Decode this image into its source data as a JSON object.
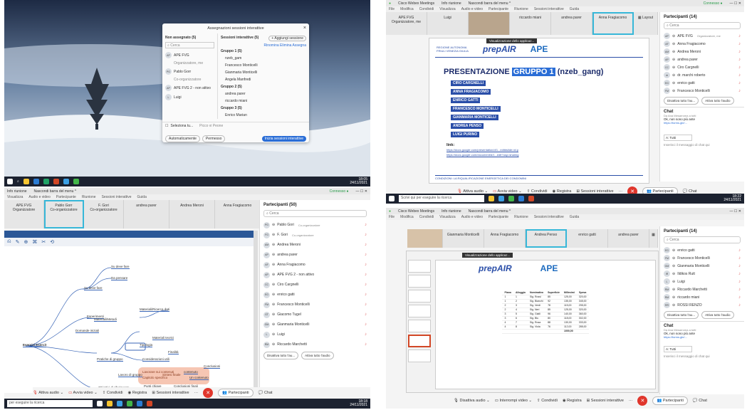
{
  "tl": {
    "dialog": {
      "title": "Assegnazioni sessioni interattive",
      "unassigned_header": "Non assegnato (5)",
      "sessions_header": "Sessioni interattive (5)",
      "add_session": "+ Aggiungi sessione",
      "search_placeholder": "Cerca",
      "actions": "Rinomina  Elimina  Assegna",
      "unassigned": [
        "APE FVG",
        "Organizzatore, me",
        "Pablo Gorr",
        "Co-organizzatore",
        "APE FVG 2 - non attivo",
        "Luigi"
      ],
      "sessions": [
        "Gruppo 1 (5)",
        "nzeb_gam",
        "Francesco Monticelli",
        "Gianmaria Monticelli",
        "Angela Manfredi",
        "Gruppo 2 (5)",
        "andrea parer",
        "riccardo miani",
        "Gruppo 3 (5)",
        "Enrico Marian"
      ],
      "select_all": "Seleziona tu...",
      "pick_participant": "Picco vi Peone",
      "btn_automatic": "Automaticamente",
      "btn_manually": "Permesso",
      "btn_start": "Inizia sessioni interattive"
    },
    "taskbar": {
      "clock": "18:05",
      "date": "24/11/2021"
    }
  },
  "tr": {
    "titlebar": [
      "Cisco Webex Meetings",
      "Info riunione",
      "Nascondi barra del menu ^"
    ],
    "connected": "Connesso ●",
    "menu": [
      "File",
      "Modifica",
      "Condividi",
      "Visualizza",
      "Audio e video",
      "Partecipante",
      "Riunione",
      "Sessioni interattive",
      "Guida"
    ],
    "tiles": [
      "APE FVG\nOrganizzatore, me",
      "Luigi",
      "",
      "riccardo miani",
      "andrea parer",
      "Anna Fragiacomo"
    ],
    "layout_btn": "Layout",
    "slide": {
      "banner": "Visualizzazione dello applicaz...",
      "logo_left": "REGIONE AUTONOMA FRIULI VENEZIA GIULIA",
      "logo_mid": "prepAIR",
      "logo_right": "APE",
      "title_pre": "PRESENTAZIONE",
      "title_hl": "GRUPPO 1",
      "title_post": "(nzeb_gang)",
      "members": [
        "CIRO CARGNELLI",
        "ANNA FRAGIACOMO",
        "ENRICO GATTI",
        "FRANCESCO MONTICELLI",
        "GIANMARIA MONTICELLI",
        "ANDREA PENSO",
        "LUIGI PURINO"
      ],
      "link_label": "link:",
      "link1": "https://docs.google.com/presentation/d/1...edit#slide=id.p",
      "link2": "https://docs.google.com/document/d/1...edit?usp=sharing",
      "footer": "CONDIZIONI: LA RIQUALIFICAZIONE ENERGETICA DEI CONDOMINI"
    },
    "people": {
      "header": "Partecipanti (14)",
      "search": "Cerca",
      "list": [
        [
          "AP",
          "APE FVG",
          "Organizzatore, me"
        ],
        [
          "AF",
          "Anna Fragiacomo",
          ""
        ],
        [
          "AM",
          "Andrea Meroni",
          ""
        ],
        [
          "AP",
          "andrea parer",
          ""
        ],
        [
          "CC",
          "Ciro Cargnelli",
          ""
        ],
        [
          "dr",
          "dr. marchi roberto",
          ""
        ],
        [
          "EG",
          "enrico gatti",
          ""
        ],
        [
          "FM",
          "Francesco Monticelli",
          ""
        ]
      ],
      "btn_mute": "Disattiva tutto l'au...",
      "btn_unmute": "Attiva tutto l'audio",
      "chat_header": "Chat",
      "chat_from": "Da Ana Mesarroma a tutti",
      "chat_msg": "Ok, non sono più ante",
      "chat_link": "https://forms.gle/...",
      "to": "A: Tutti",
      "input": "Inserisci il messaggio di chat qui"
    },
    "controls": [
      "Attiva audio",
      "Avvia video",
      "Condividi",
      "Registra",
      "Sessioni interattive",
      "Partecipanti",
      "Chat"
    ],
    "taskbar": {
      "search": "Scrivi qui per eseguire la ricerca",
      "clock": "18:22",
      "date": "24/11/2021"
    }
  },
  "bl": {
    "titlebar": [
      "Info riunione",
      "Nascondi barra del menu ^"
    ],
    "connected": "Connesso ●",
    "menu": [
      "Visualizza",
      "Audio e video",
      "Partecipante",
      "Riunione",
      "Sessioni interattive",
      "Guida"
    ],
    "tiles": [
      "APE FVG\nOrganizzatore",
      "Pablo Gorr\nCo-organizzatore",
      "F. Gori\nCo-organizzatore",
      "andrea parer",
      "Andrea Meroni",
      "Anna Fragiacomo"
    ],
    "mindmap": {
      "root": "Esercizi Esercit",
      "nodes": [
        "Su deve fare",
        "Su deve fare",
        "Da pensare",
        "Esperimenti",
        "Materiali/Metodi",
        "Materiali/Ricerca dati",
        "Domande iniziali",
        "Materiali teorici",
        "Tipologia",
        "Finalità",
        "Pratiche di gruppo",
        "Considerazioni utili",
        "Obiettivi di riferimento",
        "Lavoro di gruppo",
        "Punti chiave",
        "Conclusioni finali",
        "A lezione",
        "contenuto",
        "Un contenuto",
        "Conclusioni"
      ],
      "pink": [
        "Lavorare sui contenuti",
        "Capitolo specifico",
        "Sintesi finale",
        "Lezione"
      ]
    },
    "people": {
      "header": "Partecipanti (50)",
      "search": "Cerca",
      "list": [
        [
          "PG",
          "Pablo Gori",
          "Co-organizzatore"
        ],
        [
          "FG",
          "F. Gori",
          "Co-organizzatore"
        ],
        [
          "AM",
          "Andrea Meroni",
          ""
        ],
        [
          "AP",
          "andrea parer",
          ""
        ],
        [
          "AF",
          "Anna Fragiacomo",
          ""
        ],
        [
          "AP",
          "APE FVG 2 - non attivo",
          ""
        ],
        [
          "CC",
          "Ciro Cargnelli",
          ""
        ],
        [
          "EG",
          "enrico gatti",
          ""
        ],
        [
          "FM",
          "Francesco Monticelli",
          ""
        ],
        [
          "GT",
          "Giacomo Tugel",
          ""
        ],
        [
          "GM",
          "Gianmaria Monticelli",
          ""
        ],
        [
          "L",
          "Luigi",
          ""
        ],
        [
          "RM",
          "Riccardo Marchetti",
          ""
        ]
      ],
      "btn_mute": "Disattiva tutto l'au...",
      "btn_unmute": "Attiva tutto l'audio"
    },
    "controls": [
      "Attiva audio",
      "Avvia video",
      "Condividi",
      "Registra",
      "Sessioni interattive",
      "Partecipanti",
      "Chat"
    ],
    "taskbar": {
      "search": "per eseguire la ricerca",
      "clock": "18:18",
      "date": "24/11/2021"
    }
  },
  "br": {
    "titlebar": [
      "Cisco Webex Meetings",
      "Info riunione",
      "Nascondi barra del menu ^"
    ],
    "menu": [
      "File",
      "Modifica",
      "Condividi",
      "Visualizza",
      "Audio e video",
      "Partecipante",
      "Riunione",
      "Sessioni interattive",
      "Guida"
    ],
    "tiles": [
      "",
      "Gianmaria Monticelli",
      "Anna Fragiacomo",
      "Andrea Penso",
      "enrico gatti",
      "andrea parer"
    ],
    "layout_btn": "Layout",
    "banner": "Visualizzazione dello applicaz...",
    "logo_mid": "prepAIR",
    "logo_right": "APE",
    "table": {
      "headers": [
        "Piano",
        "Alloggio",
        "Nominativo",
        "Superficie",
        "Millesimi",
        "Spesa"
      ],
      "rows": [
        [
          "1",
          "1",
          "Sig. Rossi",
          "85",
          "125,00",
          "320,00"
        ],
        [
          "1",
          "2",
          "Sig. Bianchi",
          "92",
          "135,00",
          "345,00"
        ],
        [
          "2",
          "3",
          "Sig. Verdi",
          "78",
          "115,00",
          "295,00"
        ],
        [
          "2",
          "4",
          "Sig. Neri",
          "85",
          "125,00",
          "320,00"
        ],
        [
          "3",
          "5",
          "Sig. Gialli",
          "96",
          "140,00",
          "360,00"
        ],
        [
          "3",
          "6",
          "Sig. Blu",
          "80",
          "118,00",
          "302,00"
        ],
        [
          "4",
          "7",
          "Sig. Rosa",
          "88",
          "130,00",
          "333,00"
        ],
        [
          "4",
          "8",
          "Sig. Viola",
          "76",
          "112,00",
          "285,00"
        ]
      ],
      "total": "1000,00"
    },
    "people": {
      "header": "Partecipanti (14)",
      "search": "Cerca",
      "list": [
        [
          "EG",
          "enrico gatti",
          ""
        ],
        [
          "FM",
          "Francesco Monticelli",
          ""
        ],
        [
          "GM",
          "Gianmaria Monticelli",
          ""
        ],
        [
          "IR",
          "Ildikos Rutt",
          ""
        ],
        [
          "L",
          "Luigi",
          ""
        ],
        [
          "RM",
          "Riccardo Marchetti",
          ""
        ],
        [
          "RM",
          "riccardo miani",
          ""
        ],
        [
          "RR",
          "ROSSI RENZO",
          ""
        ]
      ],
      "btn_mute": "Disattiva tutto l'au...",
      "btn_unmute": "Attiva tutto l'audio",
      "chat_header": "Chat",
      "chat_from": "Da Ana Mesarroma a tutti",
      "chat_msg": "Ok, non sono più ante",
      "chat_link": "https://forms.gle/...",
      "to": "A: Tutti",
      "input": "Inserisci il messaggio di chat qui"
    },
    "controls": [
      "Disattiva audio",
      "Interrompi video",
      "Condividi",
      "Registra",
      "Sessioni interattive",
      "Partecipanti",
      "Chat"
    ]
  }
}
